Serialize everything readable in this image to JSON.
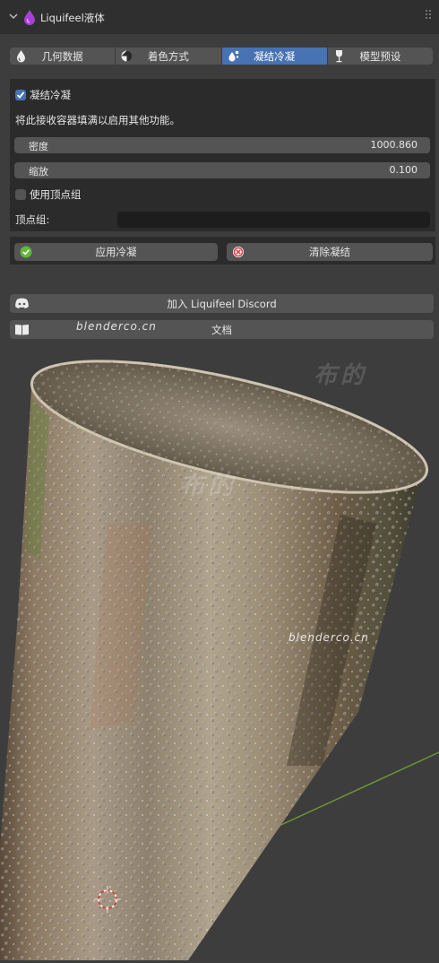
{
  "panel": {
    "title": "Liquifeel液体"
  },
  "tabs": [
    {
      "label": "几何数据",
      "icon": "liquid-drop-icon",
      "active": false
    },
    {
      "label": "着色方式",
      "icon": "shading-sphere-icon",
      "active": false
    },
    {
      "label": "凝结冷凝",
      "icon": "condensation-drops-icon",
      "active": true
    },
    {
      "label": "模型预设",
      "icon": "wine-glass-icon",
      "active": false
    }
  ],
  "condensation": {
    "enable_label": "凝结冷凝",
    "enabled": true,
    "info_text": "将此接收容器填满以启用其他功能。",
    "density_label": "密度",
    "density_value": "1000.860",
    "scale_label": "缩放",
    "scale_value": "0.100",
    "use_vertex_group_label": "使用顶点组",
    "use_vertex_group": false,
    "vertex_group_label": "顶点组:",
    "vertex_group_value": ""
  },
  "actions": {
    "apply_label": "应用冷凝",
    "clear_label": "清除凝结"
  },
  "links": {
    "discord_label": "加入 Liquifeel Discord",
    "docs_label": "文档"
  },
  "watermarks": {
    "site_top": "blenderco.cn",
    "site_mid": "blenderco.cn",
    "brand_1": "布的",
    "brand_2": "布的"
  },
  "colors": {
    "accent": "#4772b3",
    "panel_bg": "#2b2b2b",
    "button_bg": "#545454",
    "viewport_bg": "#3d3d3d",
    "apply_icon": "#5fb83a",
    "clear_icon": "#d94040"
  }
}
